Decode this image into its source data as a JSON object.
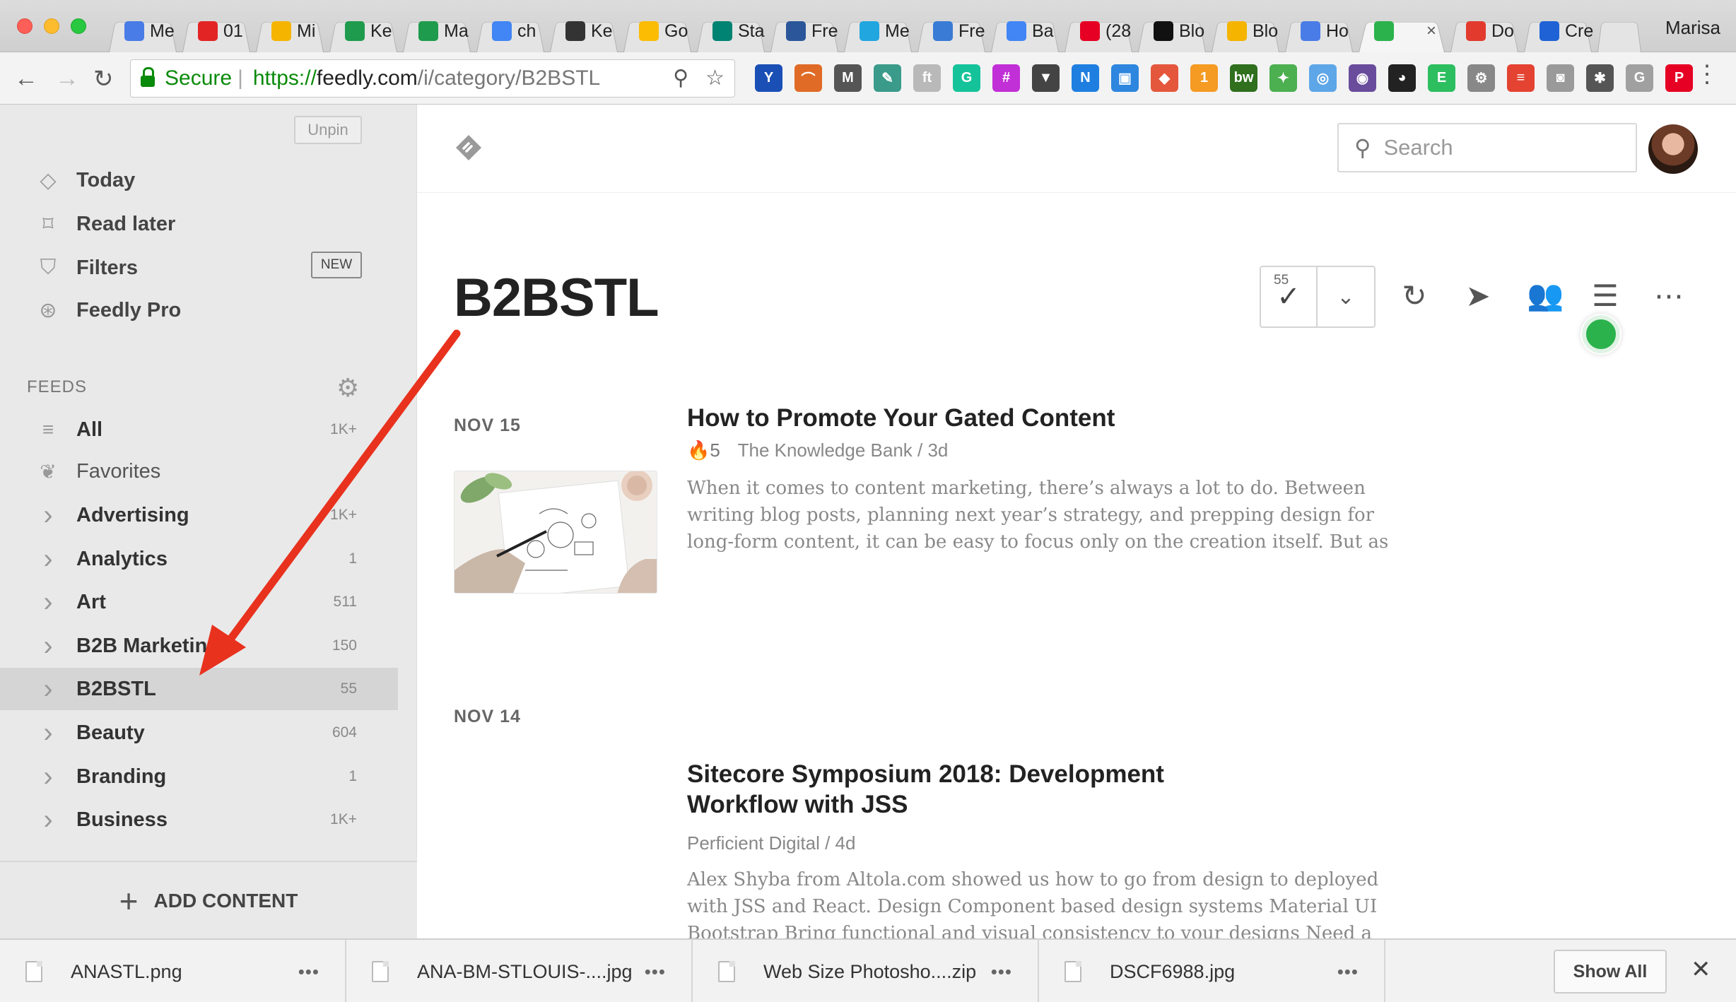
{
  "browser": {
    "tabs": [
      {
        "label": "Me",
        "icon": "docs-icon",
        "color": "#4a7ce8"
      },
      {
        "label": "01",
        "icon": "power-icon",
        "color": "#e32424"
      },
      {
        "label": "Mi",
        "icon": "drive-icon",
        "color": "#f4b400"
      },
      {
        "label": "Ke",
        "icon": "sheets-icon",
        "color": "#1e9b4c"
      },
      {
        "label": "Ma",
        "icon": "sheets-icon",
        "color": "#1e9b4c"
      },
      {
        "label": "ch",
        "icon": "google-icon",
        "color": "#4285f4"
      },
      {
        "label": "Ke",
        "icon": "m-icon",
        "color": "#333333"
      },
      {
        "label": "Go",
        "icon": "ads-icon",
        "color": "#fbbc04"
      },
      {
        "label": "Sta",
        "icon": "bing-icon",
        "color": "#008373"
      },
      {
        "label": "Fre",
        "icon": "word-icon",
        "color": "#2b579a"
      },
      {
        "label": "Me",
        "icon": "m-icon",
        "color": "#21a6e0"
      },
      {
        "label": "Fre",
        "icon": "wave-icon",
        "color": "#3a7bd5"
      },
      {
        "label": "Ba",
        "icon": "google-icon",
        "color": "#4285f4"
      },
      {
        "label": "(28",
        "icon": "pinterest-icon",
        "color": "#e60023"
      },
      {
        "label": "Blo",
        "icon": "mm-icon",
        "color": "#111111"
      },
      {
        "label": "Blo",
        "icon": "drive-icon",
        "color": "#f4b400"
      },
      {
        "label": "Ho",
        "icon": "docs-icon",
        "color": "#4a7ce8"
      },
      {
        "label": "",
        "icon": "feedly-icon",
        "color": "#2bb24c",
        "active": true,
        "close": "×"
      },
      {
        "label": "Do",
        "icon": "flag-icon",
        "color": "#e23b2e"
      },
      {
        "label": "Cre",
        "icon": "flag-icon",
        "color": "#1f62d6"
      },
      {
        "label": "",
        "icon": "new-tab",
        "color": "#d0d0d0"
      }
    ],
    "profile_name": "Marisa",
    "secure_label": "Secure",
    "url_scheme": "https://",
    "url_host": "feedly.com",
    "url_path": "/i/category/B2BSTL",
    "extensions": [
      {
        "icon": "y-icon",
        "color": "#1a4fb5",
        "glyph": "Y"
      },
      {
        "icon": "arc-icon",
        "color": "#e06b26",
        "glyph": "⌒"
      },
      {
        "icon": "m-icon",
        "color": "#555555",
        "glyph": "M"
      },
      {
        "icon": "dropper-icon",
        "color": "#3a9b8a",
        "glyph": "✎"
      },
      {
        "icon": "hootlet-icon",
        "color": "#b9b9b9",
        "glyph": "ft"
      },
      {
        "icon": "grammarly-icon",
        "color": "#15c39a",
        "glyph": "G"
      },
      {
        "icon": "hash-icon",
        "color": "#c12fd6",
        "glyph": "#"
      },
      {
        "icon": "pocket-icon",
        "color": "#444444",
        "glyph": "▼"
      },
      {
        "icon": "new-icon",
        "color": "#1e7fe0",
        "glyph": "N"
      },
      {
        "icon": "screen-icon",
        "color": "#2e86de",
        "glyph": "▣"
      },
      {
        "icon": "diamond-icon",
        "color": "#e4573d",
        "glyph": "◆"
      },
      {
        "icon": "badge-icon",
        "color": "#f59a23",
        "glyph": "1"
      },
      {
        "icon": "bw-icon",
        "color": "#2f6f1e",
        "glyph": "bw"
      },
      {
        "icon": "leaf-icon",
        "color": "#4caf50",
        "glyph": "✦"
      },
      {
        "icon": "cast-icon",
        "color": "#5da6e8",
        "glyph": "◎"
      },
      {
        "icon": "orb-icon",
        "color": "#6a4c9c",
        "glyph": "◉"
      },
      {
        "icon": "owl-icon",
        "color": "#222222",
        "glyph": "◕"
      },
      {
        "icon": "evernote-icon",
        "color": "#2dbe60",
        "glyph": "E"
      },
      {
        "icon": "gear-x-icon",
        "color": "#888888",
        "glyph": "⚙"
      },
      {
        "icon": "todoist-icon",
        "color": "#e44332",
        "glyph": "≡"
      },
      {
        "icon": "camera-icon",
        "color": "#9a9a9a",
        "glyph": "◙"
      },
      {
        "icon": "bulb-icon",
        "color": "#555555",
        "glyph": "✱"
      },
      {
        "icon": "g-icon",
        "color": "#a0a0a0",
        "glyph": "G"
      },
      {
        "icon": "pinterest-icon",
        "color": "#e60023",
        "glyph": "P"
      }
    ]
  },
  "sidebar": {
    "unpin_label": "Unpin",
    "nav": [
      {
        "label": "Today",
        "icon": "today-icon",
        "glyph": "◇"
      },
      {
        "label": "Read later",
        "icon": "bookmark-icon",
        "glyph": "⌑"
      },
      {
        "label": "Filters",
        "icon": "filter-icon",
        "glyph": "⛉",
        "badge": "NEW"
      },
      {
        "label": "Feedly Pro",
        "icon": "pro-icon",
        "glyph": "⊛"
      }
    ],
    "feeds_label": "FEEDS",
    "feeds": [
      {
        "label": "All",
        "count": "1K+",
        "icon": "list-icon",
        "glyph": "≡"
      },
      {
        "label": "Favorites",
        "count": "",
        "icon": "laurel-icon",
        "glyph": "❦",
        "light": true
      },
      {
        "label": "Advertising",
        "count": "1K+",
        "icon": "chevron-right-icon",
        "glyph": "›"
      },
      {
        "label": "Analytics",
        "count": "1",
        "icon": "chevron-right-icon",
        "glyph": "›"
      },
      {
        "label": "Art",
        "count": "511",
        "icon": "chevron-right-icon",
        "glyph": "›"
      },
      {
        "label": "B2B Marketing",
        "count": "150",
        "icon": "chevron-right-icon",
        "glyph": "›"
      },
      {
        "label": "B2BSTL",
        "count": "55",
        "icon": "chevron-right-icon",
        "glyph": "›",
        "selected": true
      },
      {
        "label": "Beauty",
        "count": "604",
        "icon": "chevron-right-icon",
        "glyph": "›"
      },
      {
        "label": "Branding",
        "count": "1",
        "icon": "chevron-right-icon",
        "glyph": "›"
      },
      {
        "label": "Business",
        "count": "1K+",
        "icon": "chevron-right-icon",
        "glyph": "›"
      }
    ],
    "add_content_label": "ADD CONTENT"
  },
  "main": {
    "search_placeholder": "Search",
    "title": "B2BSTL",
    "unread_count": "55",
    "articles": [
      {
        "date": "NOV 15",
        "title": "How to Promote Your Gated Content",
        "engagement": "5",
        "source": "The Knowledge Bank / 3d",
        "excerpt": "When it comes to content marketing, there’s always a lot to do. Between writing blog posts, planning next year’s strategy, and prepping design for long-form content, it can be easy to focus only on the creation itself. But as with any great"
      },
      {
        "date": "NOV 14",
        "title": "Sitecore Symposium 2018: Development Workflow with JSS",
        "engagement": "",
        "source": "Perficient Digital / 4d",
        "excerpt": "Alex Shyba from Altola.com showed us how to go from design to deployed with JSS and React. Design Component based design systems Material UI Bootstrap Bring functional and visual consistency to your designs Need a single source of"
      }
    ]
  },
  "downloads": {
    "items": [
      {
        "name": "ANASTL.png"
      },
      {
        "name": "ANA-BM-STLOUIS-....jpg"
      },
      {
        "name": "Web Size Photosho....zip"
      },
      {
        "name": "DSCF6988.jpg"
      }
    ],
    "show_all_label": "Show All"
  },
  "colors": {
    "accent_green": "#2bb24c",
    "annotation_arrow": "#e8321e"
  }
}
